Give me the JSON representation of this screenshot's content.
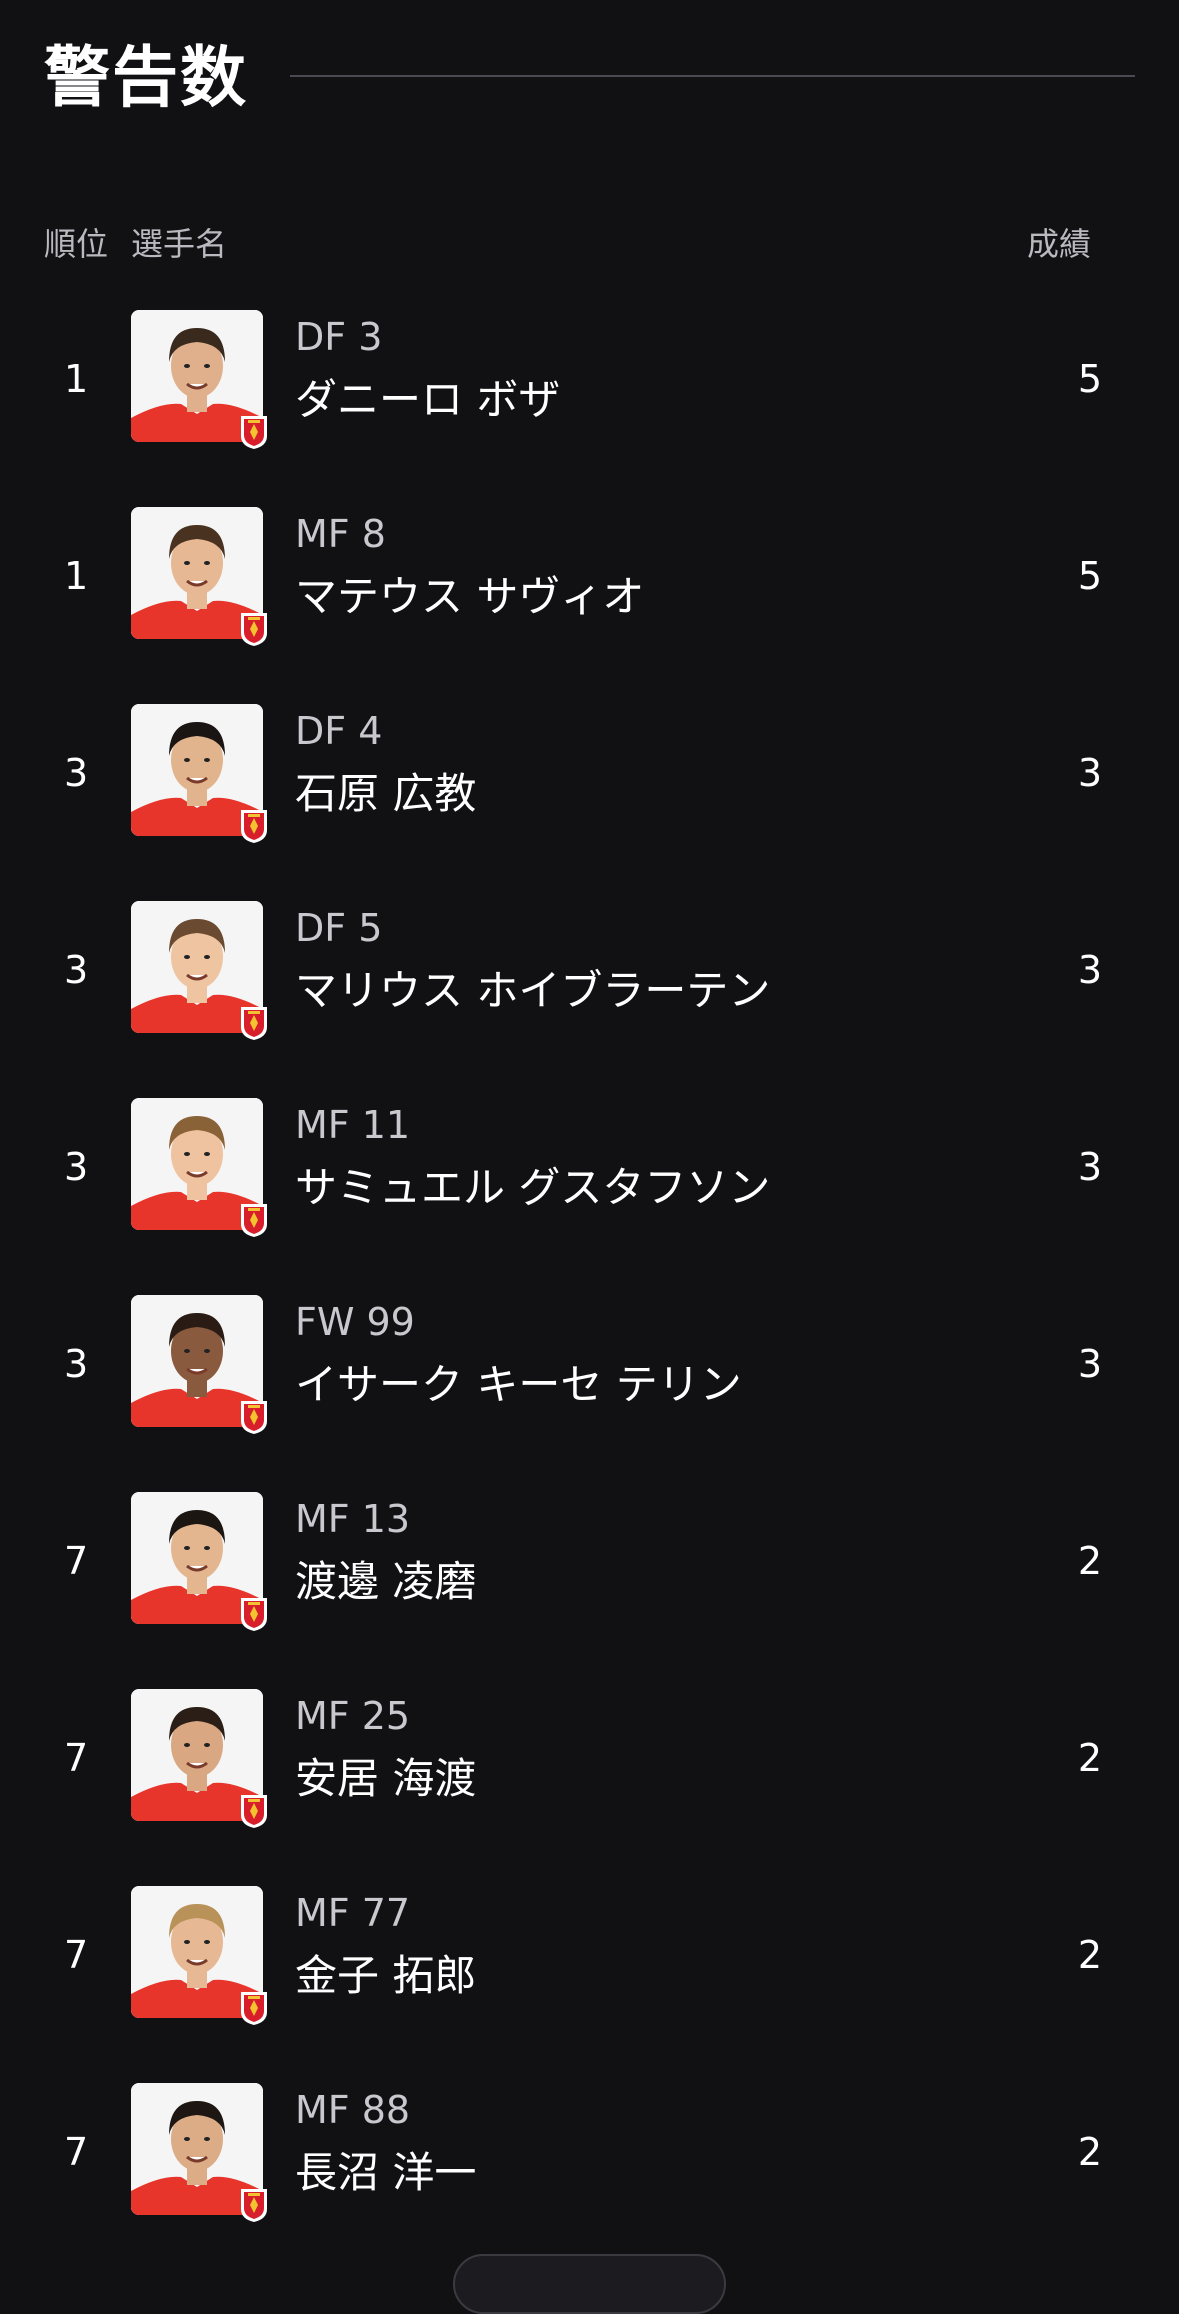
{
  "section": {
    "title": "警告数"
  },
  "table": {
    "headers": {
      "rank": "順位",
      "player": "選手名",
      "result": "成績"
    },
    "rows": [
      {
        "rank": "1",
        "position": "DF 3",
        "name": "ダニーロ ボザ",
        "value": "5",
        "hair": "#3a2a1e",
        "skin": "#e0b08c"
      },
      {
        "rank": "1",
        "position": "MF 8",
        "name": "マテウス サヴィオ",
        "value": "5",
        "hair": "#4a3220",
        "skin": "#e6b894"
      },
      {
        "rank": "3",
        "position": "DF 4",
        "name": "石原 広教",
        "value": "3",
        "hair": "#1a1512",
        "skin": "#e2b48e"
      },
      {
        "rank": "3",
        "position": "DF 5",
        "name": "マリウス ホイブラーテン",
        "value": "3",
        "hair": "#6a4a30",
        "skin": "#efc4a0"
      },
      {
        "rank": "3",
        "position": "MF 11",
        "name": "サミュエル グスタフソン",
        "value": "3",
        "hair": "#8a6238",
        "skin": "#efc2a0"
      },
      {
        "rank": "3",
        "position": "FW 99",
        "name": "イサーク キーセ テリン",
        "value": "3",
        "hair": "#2a1c14",
        "skin": "#8a5a3e"
      },
      {
        "rank": "7",
        "position": "MF 13",
        "name": "渡邊 凌磨",
        "value": "2",
        "hair": "#1c1612",
        "skin": "#e4b690"
      },
      {
        "rank": "7",
        "position": "MF 25",
        "name": "安居 海渡",
        "value": "2",
        "hair": "#2a1e16",
        "skin": "#d9a882"
      },
      {
        "rank": "7",
        "position": "MF 77",
        "name": "金子 拓郎",
        "value": "2",
        "hair": "#b89258",
        "skin": "#e6b894"
      },
      {
        "rank": "7",
        "position": "MF 88",
        "name": "長沼 洋一",
        "value": "2",
        "hair": "#1e1612",
        "skin": "#dcac86"
      }
    ]
  },
  "colors": {
    "background": "#111114",
    "jersey": "#e8352b",
    "crest_red": "#d81e2a",
    "divider": "#4a4a50",
    "secondary_text": "#b9b9bf"
  },
  "icons": {
    "player_photo": "player-photo",
    "club_crest": "club-crest-icon"
  }
}
